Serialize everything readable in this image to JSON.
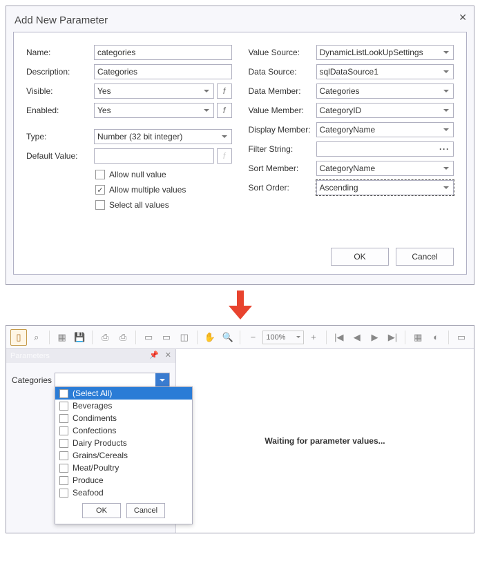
{
  "dialog": {
    "title": "Add New Parameter",
    "left": {
      "name": {
        "label": "Name:",
        "value": "categories"
      },
      "description": {
        "label": "Description:",
        "value": "Categories"
      },
      "visible": {
        "label": "Visible:",
        "value": "Yes"
      },
      "enabled": {
        "label": "Enabled:",
        "value": "Yes"
      },
      "type": {
        "label": "Type:",
        "value": "Number (32 bit integer)"
      },
      "default": {
        "label": "Default Value:",
        "value": ""
      },
      "checks": {
        "allowNull": {
          "label": "Allow null value",
          "checked": false
        },
        "allowMulti": {
          "label": "Allow multiple values",
          "checked": true
        },
        "selectAll": {
          "label": "Select all values",
          "checked": false
        }
      }
    },
    "right": {
      "valueSource": {
        "label": "Value Source:",
        "value": "DynamicListLookUpSettings"
      },
      "dataSource": {
        "label": "Data Source:",
        "value": "sqlDataSource1"
      },
      "dataMember": {
        "label": "Data Member:",
        "value": "Categories"
      },
      "valueMember": {
        "label": "Value Member:",
        "value": "CategoryID"
      },
      "displayMember": {
        "label": "Display Member:",
        "value": "CategoryName"
      },
      "filterString": {
        "label": "Filter String:",
        "value": ""
      },
      "sortMember": {
        "label": "Sort Member:",
        "value": "CategoryName"
      },
      "sortOrder": {
        "label": "Sort Order:",
        "value": "Ascending"
      }
    },
    "ok": "OK",
    "cancel": "Cancel"
  },
  "preview": {
    "zoom": "100%",
    "sideTitle": "Parameters",
    "paramLabel": "Categories",
    "ddItems": [
      "(Select All)",
      "Beverages",
      "Condiments",
      "Confections",
      "Dairy Products",
      "Grains/Cereals",
      "Meat/Poultry",
      "Produce",
      "Seafood"
    ],
    "ok": "OK",
    "cancel": "Cancel",
    "waiting": "Waiting for parameter values..."
  }
}
